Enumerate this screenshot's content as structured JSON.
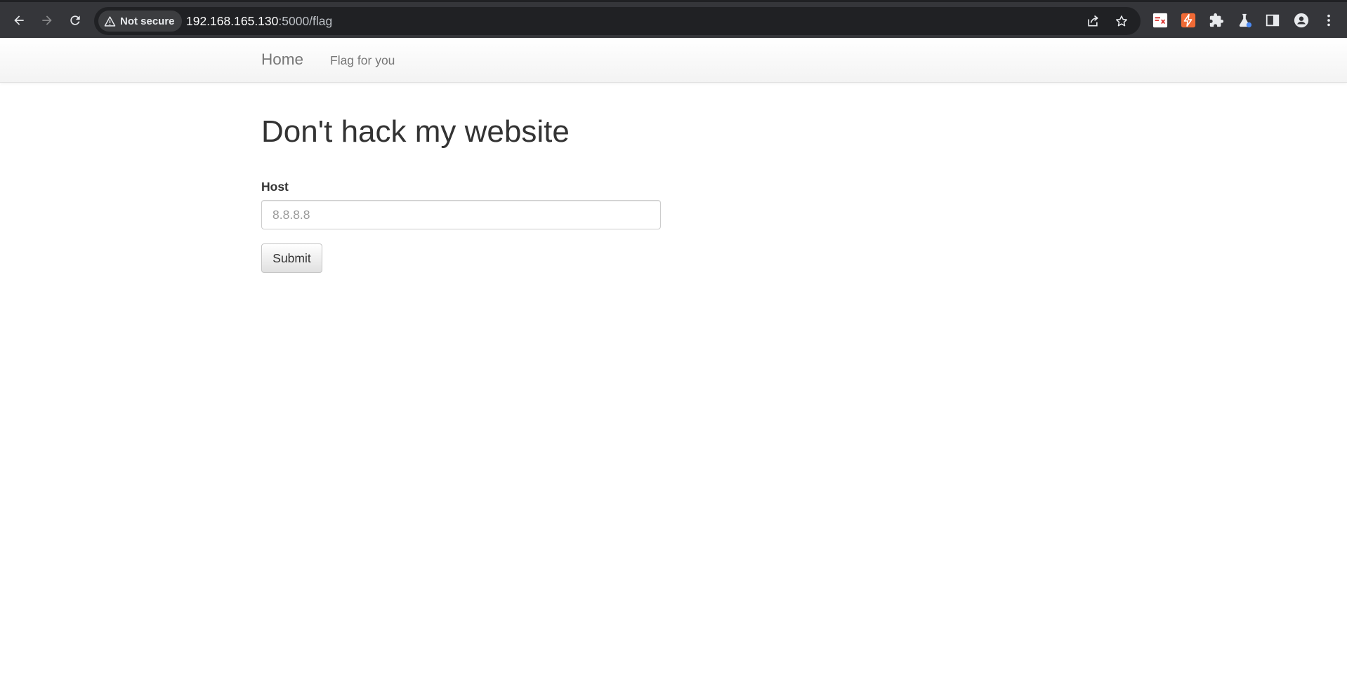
{
  "browser": {
    "security_label": "Not secure",
    "url_host": "192.168.165.130",
    "url_path": ":5000/flag",
    "icons": {
      "back": "arrow-left-icon",
      "forward": "arrow-right-icon",
      "reload": "reload-icon",
      "warning": "warning-triangle-icon",
      "share": "share-icon",
      "bookmark": "star-icon",
      "extension_1": "hackbar-extension-icon",
      "extension_2": "bolt-extension-icon",
      "extensions": "puzzle-icon",
      "labs": "flask-icon",
      "side_panel": "side-panel-icon",
      "profile": "profile-icon",
      "menu": "kebab-menu-icon"
    },
    "colors": {
      "toolbar": "#35363a",
      "omnibox": "#202124",
      "extension_2_accent": "#f06a35",
      "labs_dot": "#4c8bf5"
    }
  },
  "navbar": {
    "brand": "Home",
    "link": "Flag for you"
  },
  "main": {
    "title": "Don't hack my website",
    "host_label": "Host",
    "host_placeholder": "8.8.8.8",
    "host_value": "",
    "submit_label": "Submit"
  }
}
